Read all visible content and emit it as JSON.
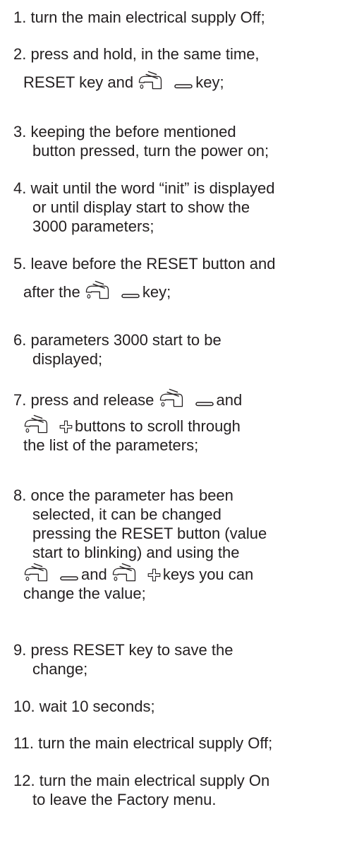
{
  "steps": [
    {
      "n": "1.",
      "lines": [
        "turn the main electrical supply Off;"
      ]
    },
    {
      "n": "2.",
      "lines": [
        "press and hold, in the same time,",
        "RESET key and",
        "key;"
      ]
    },
    {
      "n": "3.",
      "lines": [
        "keeping the before mentioned",
        "button pressed, turn the power on;"
      ]
    },
    {
      "n": "4.",
      "lines": [
        "wait until the word “init” is displayed",
        "or until display start to show the",
        "3000 parameters;"
      ]
    },
    {
      "n": "5.",
      "lines": [
        "leave before the RESET button and",
        "after the",
        "key;"
      ]
    },
    {
      "n": "6.",
      "lines": [
        "parameters 3000 start to be",
        "displayed;"
      ]
    },
    {
      "n": "7.",
      "lines": [
        "press and release",
        "and",
        "buttons to scroll through",
        "the list of the parameters;"
      ]
    },
    {
      "n": "8.",
      "lines": [
        "once the parameter has been",
        "selected, it can be changed",
        "pressing the RESET button (value",
        "start to blinking) and using the",
        "and",
        "keys you can",
        "change the value;"
      ]
    },
    {
      "n": "9.",
      "lines": [
        "press RESET key to save the",
        "change;"
      ]
    },
    {
      "n": "10.",
      "lines": [
        "wait 10 seconds;"
      ]
    },
    {
      "n": "11.",
      "lines": [
        "turn the main electrical supply Off;"
      ]
    },
    {
      "n": "12.",
      "lines": [
        "turn the main electrical supply On",
        "to leave the Factory menu."
      ]
    }
  ],
  "icons": {
    "minus_key": "faucet-minus-icon",
    "plus_key": "faucet-plus-icon"
  }
}
